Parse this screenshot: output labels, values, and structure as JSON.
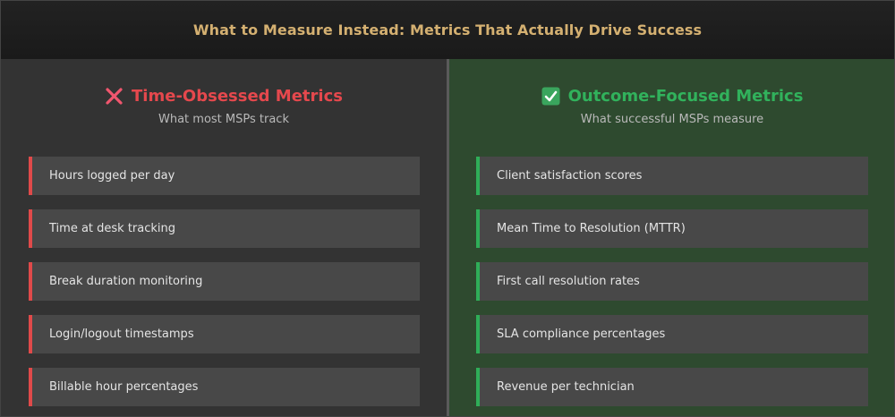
{
  "header": {
    "title": "What to Measure Instead: Metrics That Actually Drive Success"
  },
  "left": {
    "icon": "cross-icon",
    "title": "Time-Obsessed Metrics",
    "subtitle": "What most MSPs track",
    "accent": "#e04a4a",
    "items": [
      "Hours logged per day",
      "Time at desk tracking",
      "Break duration monitoring",
      "Login/logout timestamps",
      "Billable hour percentages"
    ]
  },
  "right": {
    "icon": "check-icon",
    "title": "Outcome-Focused Metrics",
    "subtitle": "What successful MSPs measure",
    "accent": "#2fae58",
    "items": [
      "Client satisfaction scores",
      "Mean Time to Resolution (MTTR)",
      "First call resolution rates",
      "SLA compliance percentages",
      "Revenue per technician"
    ]
  }
}
